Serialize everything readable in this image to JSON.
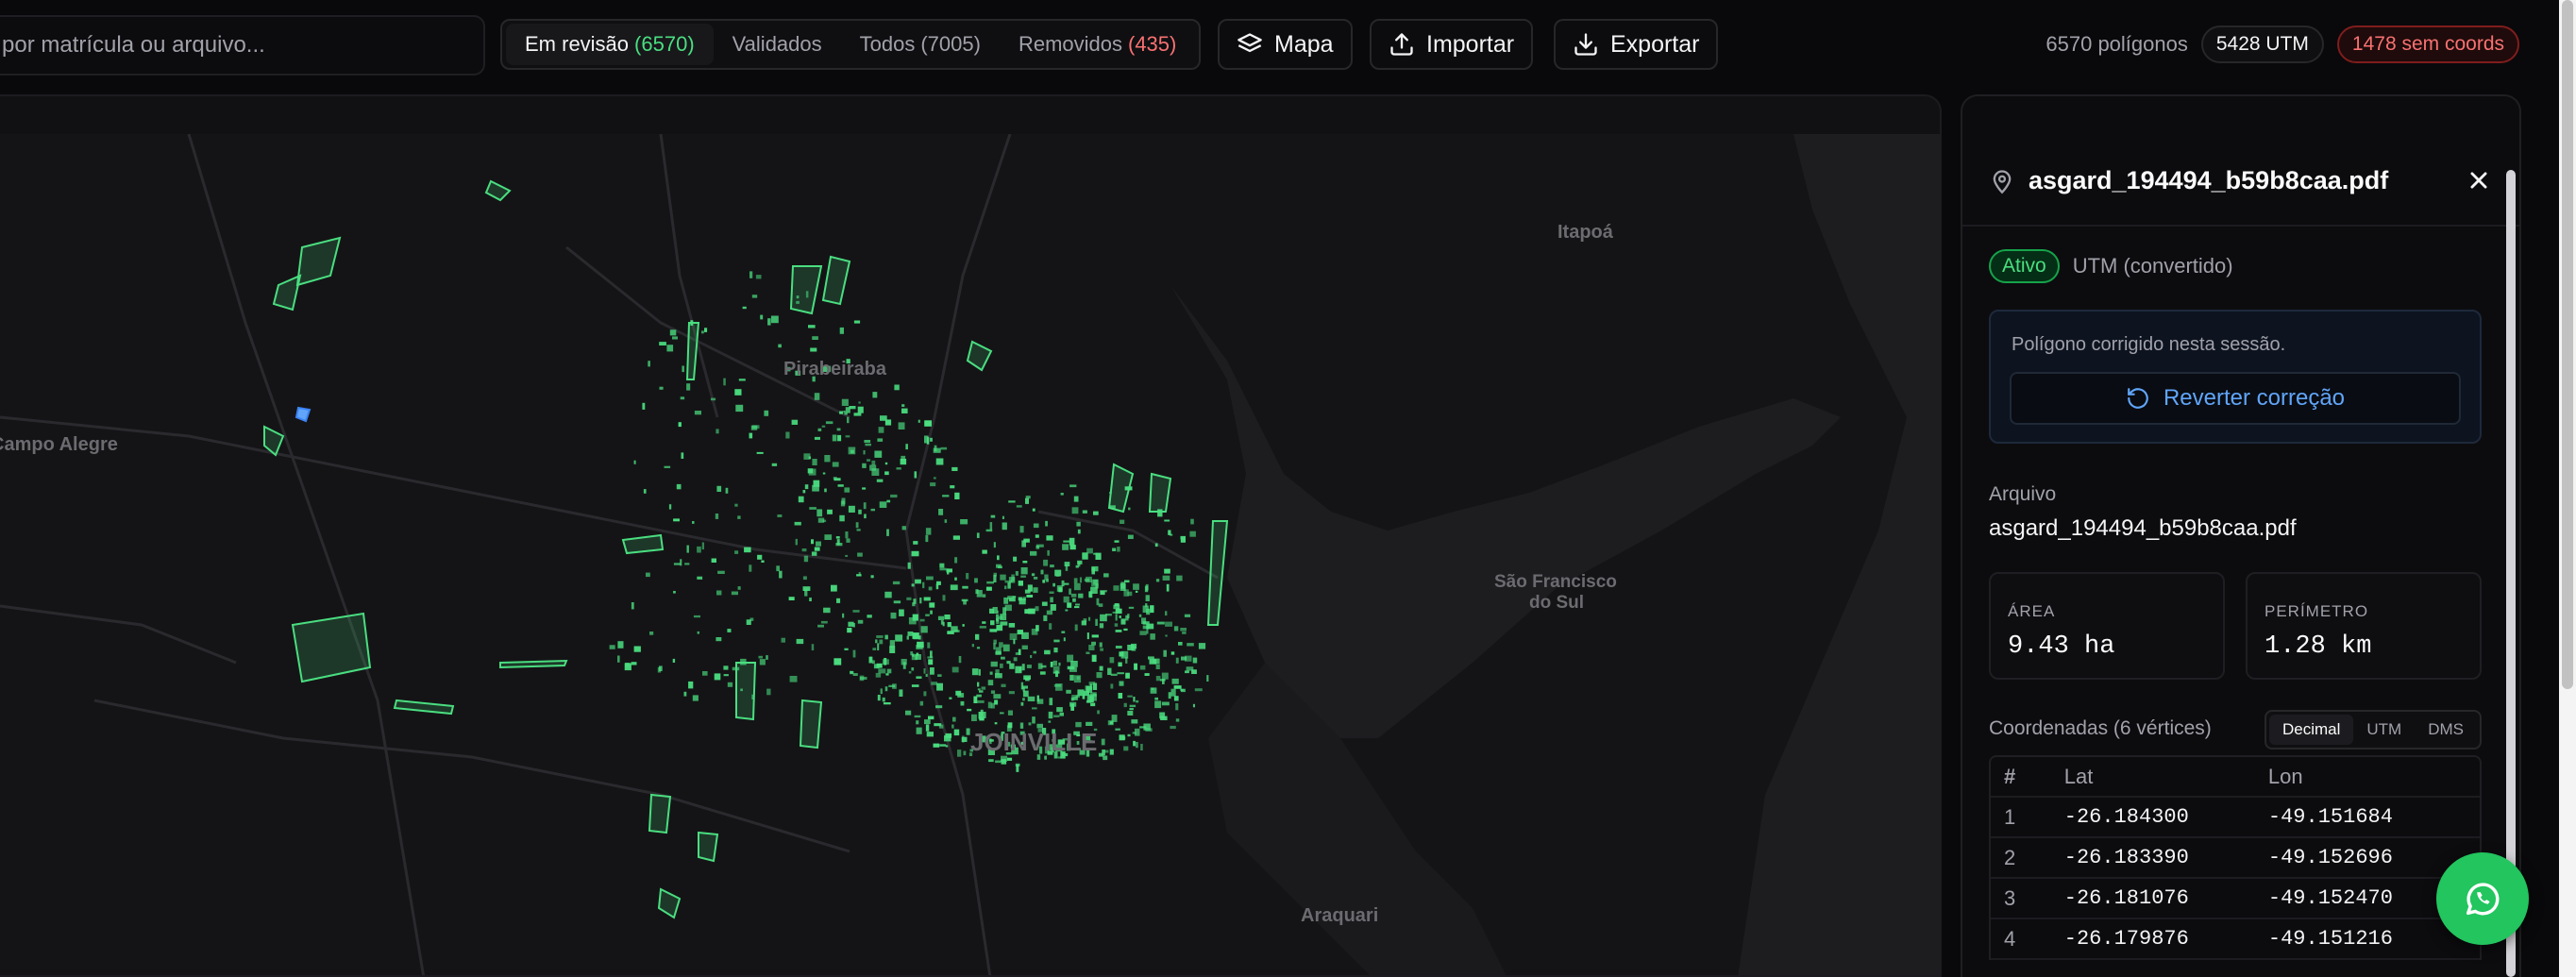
{
  "search": {
    "placeholder": "por matrícula ou arquivo..."
  },
  "filters": [
    {
      "label": "Em revisão",
      "count": "(6570)",
      "count_color": "green",
      "active": true
    },
    {
      "label": "Validados",
      "count": "",
      "active": false
    },
    {
      "label": "Todos",
      "count": "(7005)",
      "count_color": "neutral",
      "active": false
    },
    {
      "label": "Removidos",
      "count": "(435)",
      "count_color": "red",
      "active": false
    }
  ],
  "toolbar": {
    "map_label": "Mapa",
    "import_label": "Importar",
    "export_label": "Exportar"
  },
  "stats": {
    "polygons": "6570 polígonos",
    "utm": "5428 UTM",
    "no_coords": "1478 sem coords"
  },
  "map": {
    "labels": [
      "Itapoá",
      "Pirabeiraba",
      "Campo Alegre",
      "São Francisco",
      "do Sul",
      "JOINVILLE",
      "Araquari"
    ]
  },
  "panel": {
    "title": "asgard_194494_b59b8caa.pdf",
    "status_badge": "Ativo",
    "status_note": "UTM (convertido)",
    "correction_text": "Polígono corrigido nesta sessão.",
    "revert_label": "Reverter correção",
    "file_label": "Arquivo",
    "file_value": "asgard_194494_b59b8caa.pdf",
    "area_label": "ÁREA",
    "area_value": "9.43 ha",
    "perimeter_label": "PERÍMETRO",
    "perimeter_value": "1.28 km",
    "coords_title": "Coordenadas (6 vértices)",
    "coord_tabs": [
      "Decimal",
      "UTM",
      "DMS"
    ],
    "table_headers": [
      "#",
      "Lat",
      "Lon"
    ],
    "rows": [
      [
        "1",
        "-26.184300",
        "-49.151684"
      ],
      [
        "2",
        "-26.183390",
        "-49.152696"
      ],
      [
        "3",
        "-26.181076",
        "-49.152470"
      ],
      [
        "4",
        "-26.179876",
        "-49.151216"
      ]
    ]
  },
  "colors": {
    "accent_green": "#4ade80",
    "danger_red": "#f87171",
    "link_blue": "#60a5fa",
    "whatsapp": "#22c55e"
  }
}
